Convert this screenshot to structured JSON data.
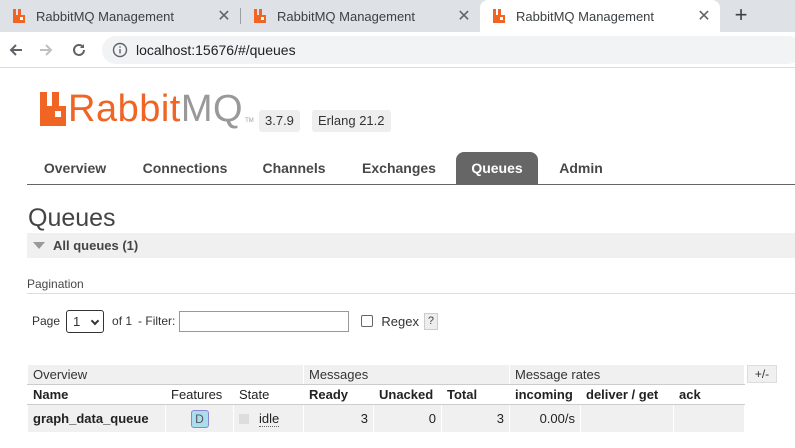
{
  "browser": {
    "tabs": [
      {
        "label": "RabbitMQ Management",
        "active": false
      },
      {
        "label": "RabbitMQ Management",
        "active": false
      },
      {
        "label": "RabbitMQ Management",
        "active": true
      }
    ],
    "url": "localhost:15676/#/queues"
  },
  "logo": {
    "rabbit": "Rabbit",
    "mq": "MQ",
    "tm": "TM"
  },
  "versions": {
    "rabbitmq": "3.7.9",
    "erlang": "Erlang 21.2"
  },
  "nav": {
    "items": [
      "Overview",
      "Connections",
      "Channels",
      "Exchanges",
      "Queues",
      "Admin"
    ],
    "selected": "Queues"
  },
  "page": {
    "title": "Queues",
    "section": "All queues (1)",
    "pagination_title": "Pagination",
    "page_label": "Page",
    "page_value": "1",
    "of_label": "of 1",
    "filter_label": "- Filter:",
    "filter_value": "",
    "regex_label": "Regex",
    "help_label": "?"
  },
  "table": {
    "groups": [
      "Overview",
      "Messages",
      "Message rates"
    ],
    "plusminus": "+/-",
    "headers": [
      "Name",
      "Features",
      "State",
      "Ready",
      "Unacked",
      "Total",
      "incoming",
      "deliver / get",
      "ack"
    ],
    "rows": [
      {
        "name": "graph_data_queue",
        "feature": "D",
        "state": "idle",
        "ready": "3",
        "unacked": "0",
        "total": "3",
        "incoming": "0.00/s",
        "deliver_get": "",
        "ack": ""
      }
    ]
  },
  "colors": {
    "brand_orange": "#f06424",
    "nav_selected": "#666666"
  }
}
